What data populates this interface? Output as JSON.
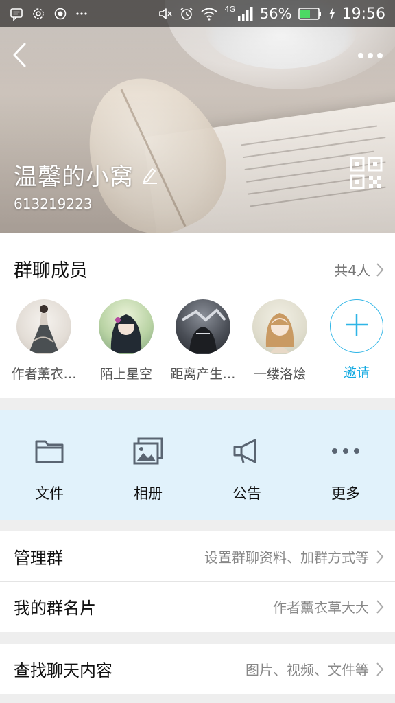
{
  "status_bar": {
    "network_type": "4G",
    "battery_percent": "56%",
    "time": "19:56",
    "left_icons": [
      "message-icon",
      "settings-icon",
      "record-icon",
      "overflow-dots-icon"
    ],
    "right_icons": [
      "mute-icon",
      "alarm-icon",
      "wifi-icon",
      "signal-icon",
      "battery-icon",
      "charging-icon"
    ],
    "battery_level": 0.56,
    "battery_color": "#4cd964"
  },
  "header": {
    "back_icon": "chevron-left-icon",
    "more_icon": "more-dots-icon",
    "group_name": "温馨的小窝",
    "group_id": "613219223",
    "edit_icon": "pencil-icon",
    "qr_icon": "qr-code-icon"
  },
  "members": {
    "title": "群聊成员",
    "count_label": "共4人",
    "list": [
      {
        "name": "作者薰衣…"
      },
      {
        "name": "陌上星空"
      },
      {
        "name": "距离产生…"
      },
      {
        "name": "一缕洛烩"
      }
    ],
    "invite_label": "邀请",
    "accent_color": "#12a9e1"
  },
  "actions": [
    {
      "label": "文件",
      "icon": "folder-icon"
    },
    {
      "label": "相册",
      "icon": "album-icon"
    },
    {
      "label": "公告",
      "icon": "megaphone-icon"
    },
    {
      "label": "更多",
      "icon": "more-dots-icon"
    }
  ],
  "settings": {
    "manage_group": {
      "title": "管理群",
      "value": "设置群聊资料、加群方式等"
    },
    "my_card": {
      "title": "我的群名片",
      "value": "作者薰衣草大大"
    },
    "search_history": {
      "title": "查找聊天内容",
      "value": "图片、视频、文件等"
    }
  }
}
